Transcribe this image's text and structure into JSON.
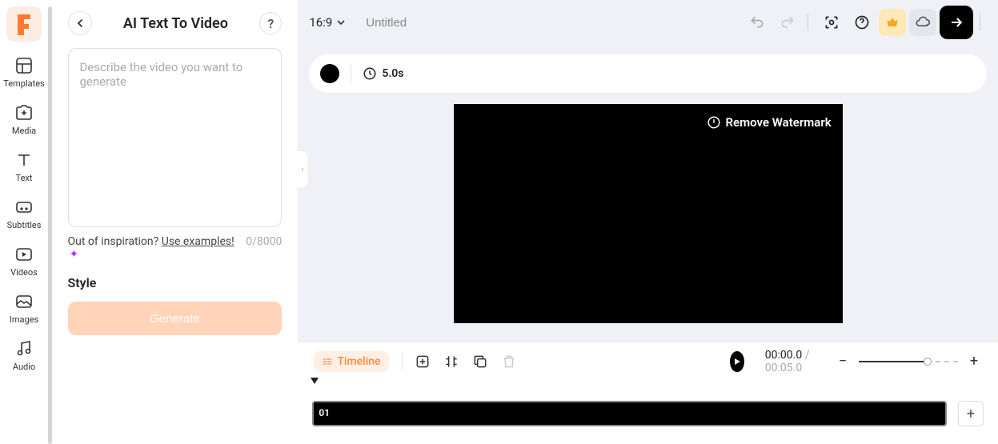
{
  "sidebar": {
    "items": [
      {
        "label": "Templates"
      },
      {
        "label": "Media"
      },
      {
        "label": "Text"
      },
      {
        "label": "Subtitles"
      },
      {
        "label": "Videos"
      },
      {
        "label": "Images"
      },
      {
        "label": "Audio"
      }
    ]
  },
  "panel": {
    "title": "AI Text To Video",
    "placeholder": "Describe the video you want to generate",
    "inspiration_prefix": "Out of inspiration? ",
    "examples_link": "Use examples!",
    "counter": "0/8000",
    "style_label": "Style",
    "generate_label": "Generate"
  },
  "topbar": {
    "ratio": "16:9",
    "title": "Untitled"
  },
  "scene": {
    "duration": "5.0s"
  },
  "preview": {
    "watermark_label": "Remove Watermark"
  },
  "controls": {
    "timeline_label": "Timeline",
    "time_current": "00:00.0",
    "time_total": "00:05.0"
  },
  "timeline": {
    "clip_number": "01"
  }
}
